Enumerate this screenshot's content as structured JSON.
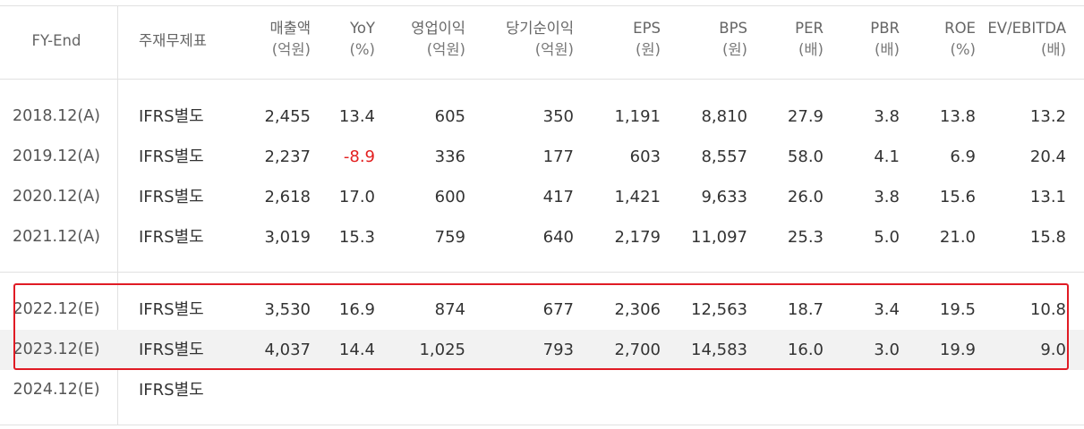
{
  "table": {
    "headers": {
      "fy": "FY-End",
      "statement": "주재무제표",
      "cols": [
        {
          "label": "매출액",
          "unit": "(억원)"
        },
        {
          "label": "YoY",
          "unit": "(%)"
        },
        {
          "label": "영업이익",
          "unit": "(억원)"
        },
        {
          "label": "당기순이익",
          "unit": "(억원)"
        },
        {
          "label": "EPS",
          "unit": "(원)"
        },
        {
          "label": "BPS",
          "unit": "(원)"
        },
        {
          "label": "PER",
          "unit": "(배)"
        },
        {
          "label": "PBR",
          "unit": "(배)"
        },
        {
          "label": "ROE",
          "unit": "(%)"
        },
        {
          "label": "EV/EBITDA",
          "unit": "(배)"
        }
      ]
    },
    "rows": [
      {
        "fy": "2018.12(A)",
        "statement": "IFRS별도",
        "values": [
          "2,455",
          "13.4",
          "605",
          "350",
          "1,191",
          "8,810",
          "27.9",
          "3.8",
          "13.8",
          "13.2"
        ]
      },
      {
        "fy": "2019.12(A)",
        "statement": "IFRS별도",
        "values": [
          "2,237",
          "-8.9",
          "336",
          "177",
          "603",
          "8,557",
          "58.0",
          "4.1",
          "6.9",
          "20.4"
        ]
      },
      {
        "fy": "2020.12(A)",
        "statement": "IFRS별도",
        "values": [
          "2,618",
          "17.0",
          "600",
          "417",
          "1,421",
          "9,633",
          "26.0",
          "3.8",
          "15.6",
          "13.1"
        ]
      },
      {
        "fy": "2021.12(A)",
        "statement": "IFRS별도",
        "values": [
          "3,019",
          "15.3",
          "759",
          "640",
          "2,179",
          "11,097",
          "25.3",
          "5.0",
          "21.0",
          "15.8"
        ]
      },
      {
        "fy": "2022.12(E)",
        "statement": "IFRS별도",
        "values": [
          "3,530",
          "16.9",
          "874",
          "677",
          "2,306",
          "12,563",
          "18.7",
          "3.4",
          "19.5",
          "10.8"
        ]
      },
      {
        "fy": "2023.12(E)",
        "statement": "IFRS별도",
        "values": [
          "4,037",
          "14.4",
          "1,025",
          "793",
          "2,700",
          "14,583",
          "16.0",
          "3.0",
          "19.9",
          "9.0"
        ]
      },
      {
        "fy": "2024.12(E)",
        "statement": "IFRS별도",
        "values": [
          "",
          "",
          "",
          "",
          "",
          "",
          "",
          "",
          "",
          ""
        ]
      }
    ],
    "negative_color": "#e32020",
    "highlight_color": "#e01b24"
  }
}
